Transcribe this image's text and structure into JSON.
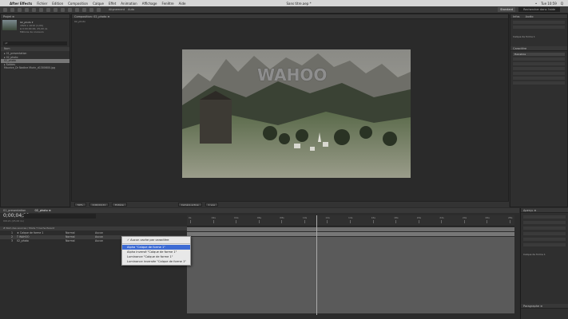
{
  "menubar": {
    "app": "After Effects",
    "items": [
      "Fichier",
      "Edition",
      "Composition",
      "Calque",
      "Effet",
      "Animation",
      "Affichage",
      "Fenêtre",
      "Aide"
    ],
    "title": "Sans titre.aep *",
    "right": [
      "•",
      "Tue 10:59",
      "Q"
    ]
  },
  "toolbar": {
    "alignement": "Alignement",
    "auto": "Auto",
    "workspace": "Standard",
    "search": "Rechercher dans l'aide"
  },
  "project": {
    "tab": "Projet ≡",
    "selected_name": "02_photo ▾",
    "info": [
      "1824 x 1010 (1,00)",
      "Δ 0:00:00:00, 25,00 i/s",
      "Millions de couleurs"
    ],
    "search_placeholder": "ρ▾",
    "header": "Nom",
    "items": [
      {
        "label": "▸ 01_presentation",
        "selected": false
      },
      {
        "label": "▸ 02_photo",
        "selected": false
      },
      {
        "label": "  02_photo",
        "selected": true
      },
      {
        "label": "▸ Solides",
        "selected": false
      },
      {
        "label": "  Maurice_Dr Nadine Murin_d1300600.jpg",
        "selected": false
      }
    ]
  },
  "comp": {
    "tab": "Composition: 02_photo ≡",
    "subtab": "02_photo",
    "overlay_text": "WAHOO",
    "zoom": "50%",
    "timecode": "0;00;04;21",
    "quality": "Entière",
    "camera": "Caméra active",
    "views": "1 vue"
  },
  "rightpanel": {
    "tabs": [
      "Infos",
      "Audio"
    ],
    "char_tab": "Caractère",
    "font": "Helvetica",
    "size": "Calque de forme 1"
  },
  "timeline": {
    "tabs": [
      "01_presentation",
      "02_photo ≡"
    ],
    "timecode": "0;00;04;21",
    "sub": "00121 (25,00 i/s)",
    "header": "# Nom des sources / Mode   T   Cache   Parent",
    "layers": [
      {
        "num": "1",
        "name": "★ Calque de forme 1",
        "mode": "Normal",
        "parent": "Aucun"
      },
      {
        "num": "2",
        "name": "T WAHOO",
        "mode": "Normal",
        "parent": "Aucun"
      },
      {
        "num": "3",
        "name": "02_photo",
        "mode": "Normal",
        "parent": "Aucun"
      }
    ],
    "ruler": [
      "0s",
      "02s",
      "04s",
      "06s",
      "08s",
      "10s",
      "12s",
      "14s",
      "16s",
      "18s",
      "20s",
      "22s",
      "24s",
      "26s",
      "28s"
    ]
  },
  "context_menu": {
    "items": [
      {
        "label": "✓ Aucun cache par caractère",
        "highlight": false
      },
      {
        "sep": true
      },
      {
        "label": "Alpha \"Calque de forme 1\"",
        "highlight": true
      },
      {
        "label": "Alpha inversé \"Calque de forme 1\"",
        "highlight": false
      },
      {
        "label": "Luminance \"Calque de forme 1\"",
        "highlight": false
      },
      {
        "label": "Luminance inversée \"Calque de forme 1\"",
        "highlight": false
      }
    ]
  },
  "rtl": {
    "tabs": [
      "Aperçu ≡"
    ],
    "items": [
      "Calque de forme 1",
      "Paragraphe ≡"
    ]
  }
}
